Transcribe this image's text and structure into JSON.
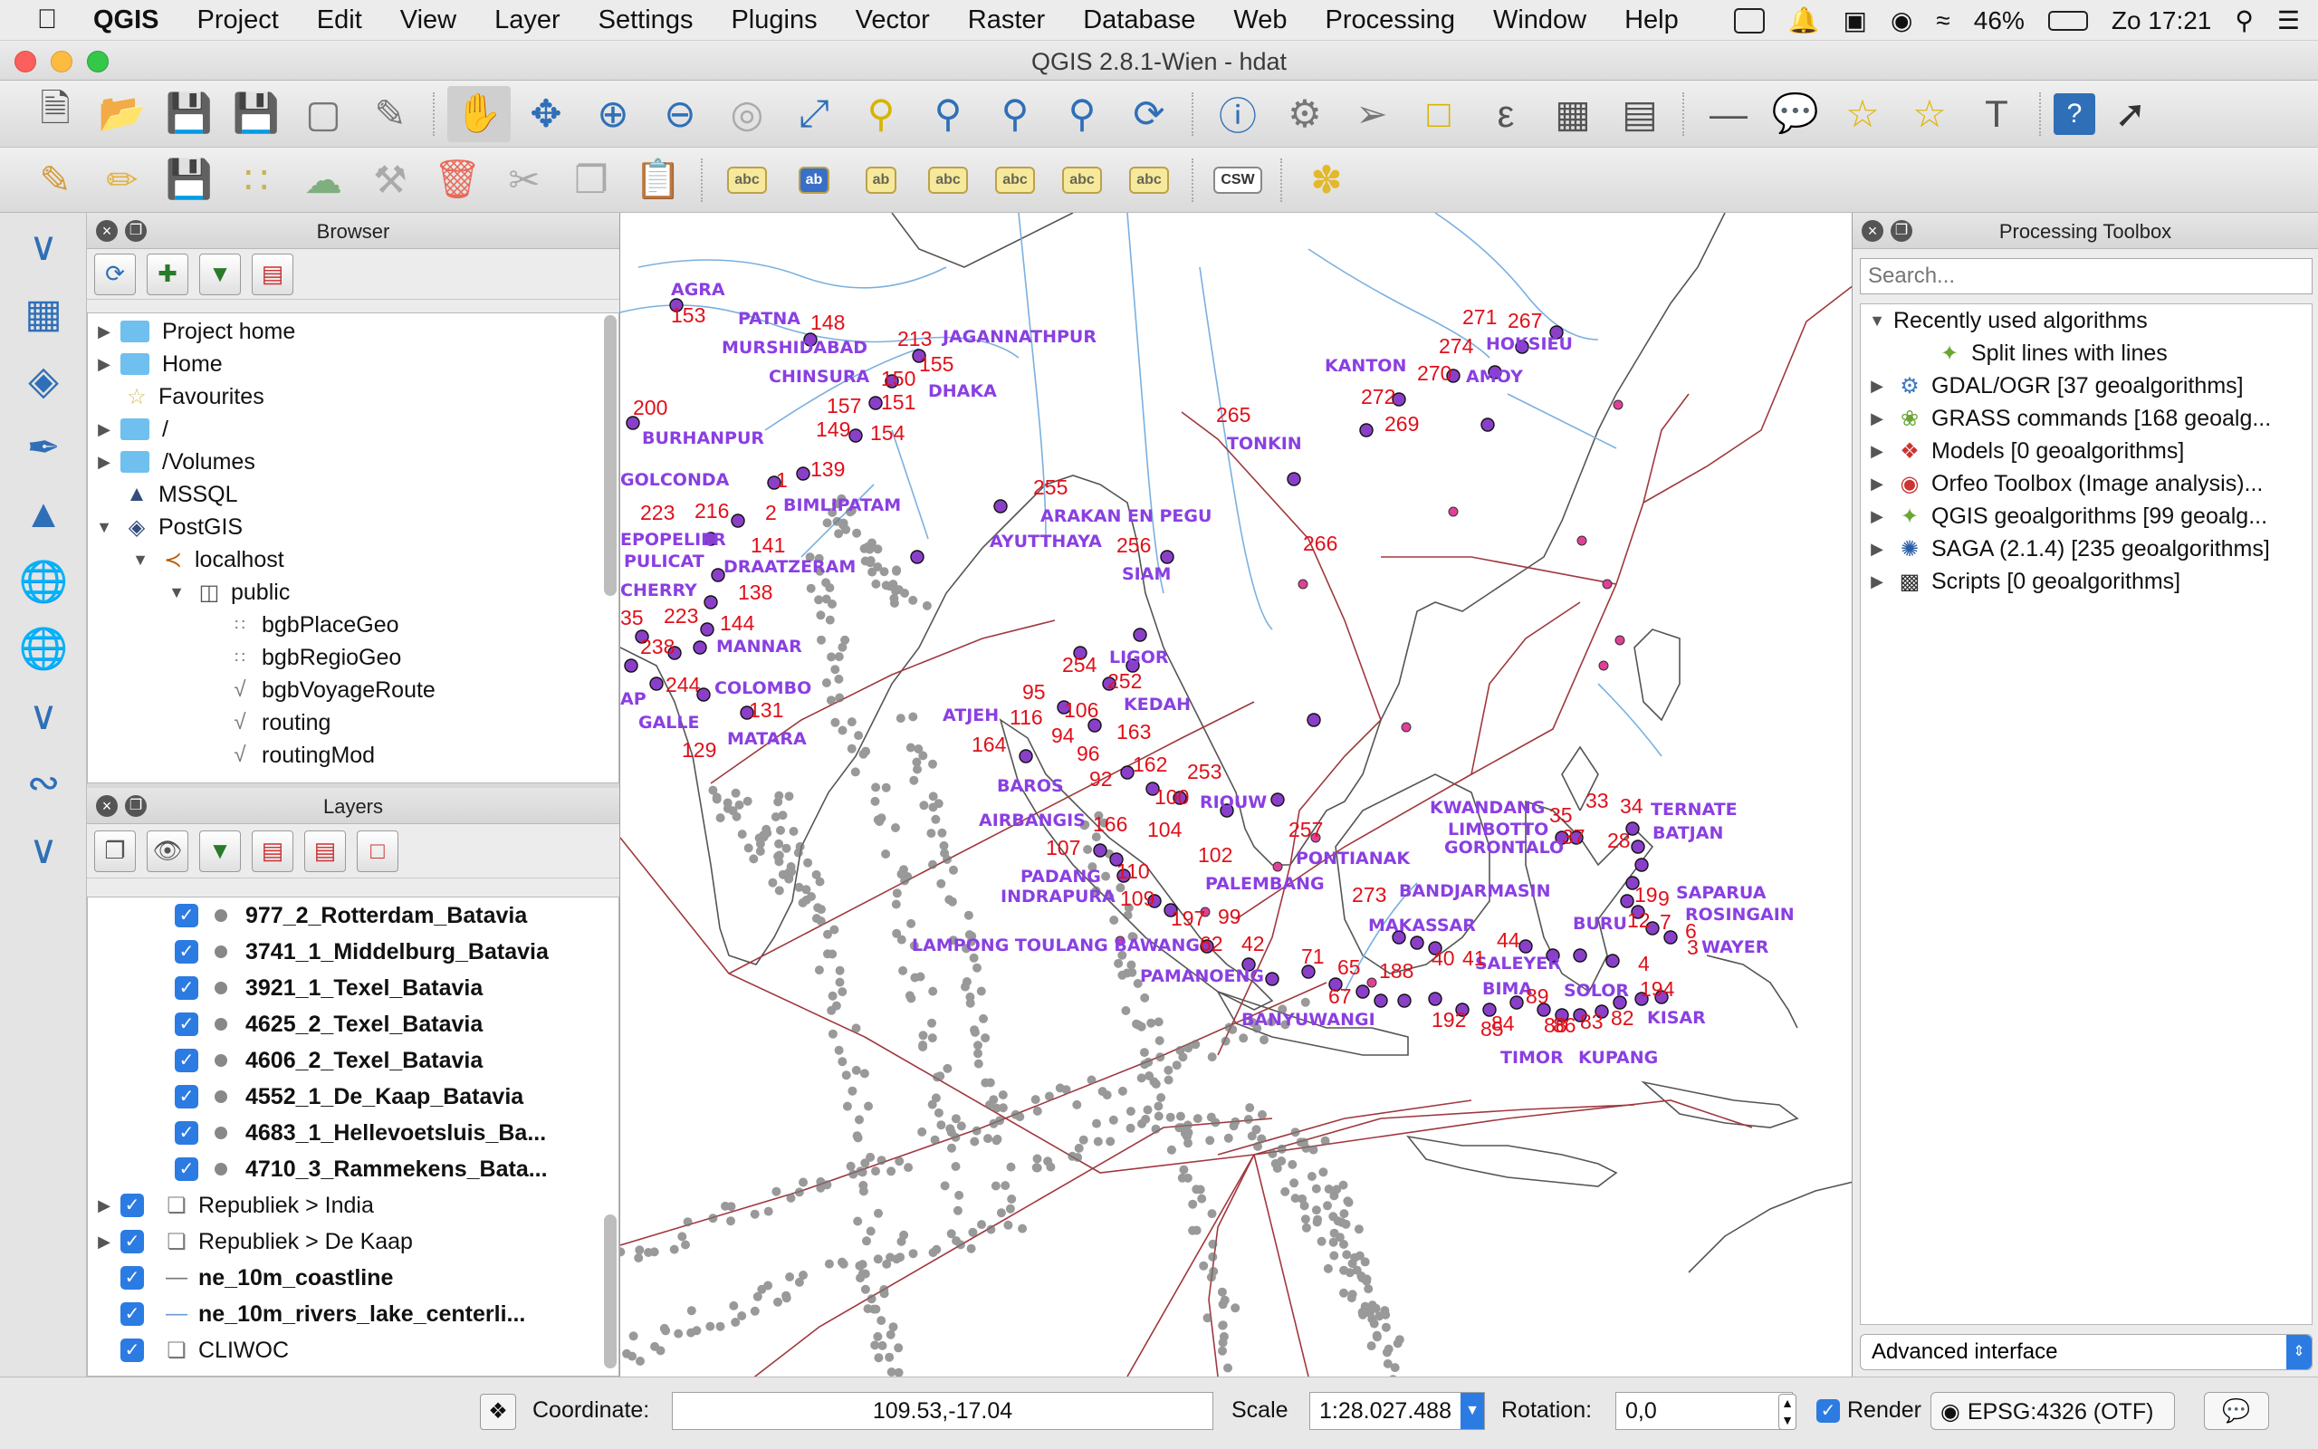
{
  "menubar": {
    "app": "QGIS",
    "items": [
      "Project",
      "Edit",
      "View",
      "Layer",
      "Settings",
      "Plugins",
      "Vector",
      "Raster",
      "Database",
      "Web",
      "Processing",
      "Window",
      "Help"
    ],
    "battery": "46%",
    "clock": "Zo 17:21"
  },
  "window": {
    "title": "QGIS 2.8.1-Wien - hdat"
  },
  "browser": {
    "title": "Browser",
    "items": [
      {
        "label": "Project home"
      },
      {
        "label": "Home"
      },
      {
        "label": "Favourites"
      },
      {
        "label": "/"
      },
      {
        "label": "/Volumes"
      },
      {
        "label": "MSSQL"
      },
      {
        "label": "PostGIS"
      },
      {
        "label": "localhost"
      },
      {
        "label": "public"
      },
      {
        "label": "bgbPlaceGeo"
      },
      {
        "label": "bgbRegioGeo"
      },
      {
        "label": "bgbVoyageRoute"
      },
      {
        "label": "routing"
      },
      {
        "label": "routingMod"
      }
    ]
  },
  "layers": {
    "title": "Layers",
    "items": [
      {
        "label": "977_2_Rotterdam_Batavia"
      },
      {
        "label": "3741_1_Middelburg_Batavia"
      },
      {
        "label": "3921_1_Texel_Batavia"
      },
      {
        "label": "4625_2_Texel_Batavia"
      },
      {
        "label": "4606_2_Texel_Batavia"
      },
      {
        "label": "4552_1_De_Kaap_Batavia"
      },
      {
        "label": "4683_1_Hellevoetsluis_Ba..."
      },
      {
        "label": "4710_3_Rammekens_Bata..."
      },
      {
        "label": "Republiek > India"
      },
      {
        "label": "Republiek > De Kaap"
      },
      {
        "label": "ne_10m_coastline"
      },
      {
        "label": "ne_10m_rivers_lake_centerli..."
      },
      {
        "label": "CLIWOC"
      }
    ]
  },
  "toolbox": {
    "title": "Processing Toolbox",
    "search_placeholder": "Search...",
    "items": [
      {
        "label": "Recently used algorithms"
      },
      {
        "label": "Split lines with lines"
      },
      {
        "label": "GDAL/OGR [37 geoalgorithms]"
      },
      {
        "label": "GRASS commands [168 geoalg..."
      },
      {
        "label": "Models [0 geoalgorithms]"
      },
      {
        "label": "Orfeo Toolbox (Image analysis)..."
      },
      {
        "label": "QGIS geoalgorithms [99 geoalg..."
      },
      {
        "label": "SAGA (2.1.4) [235 geoalgorithms]"
      },
      {
        "label": "Scripts [0 geoalgorithms]"
      }
    ],
    "mode": "Advanced interface"
  },
  "map": {
    "places": [
      {
        "label": "AGRA"
      },
      {
        "label": "PATNA"
      },
      {
        "label": "MURSHIDABAD"
      },
      {
        "label": "JAGANNATHPUR"
      },
      {
        "label": "CHINSURA"
      },
      {
        "label": "DHAKA"
      },
      {
        "label": "BURHANPUR"
      },
      {
        "label": "GOLCONDA"
      },
      {
        "label": "BIMLIPATAM"
      },
      {
        "label": "EPOPELIER"
      },
      {
        "label": "PULICAT"
      },
      {
        "label": "DRAATZERAM"
      },
      {
        "label": "CHERRY"
      },
      {
        "label": "MANNAR"
      },
      {
        "label": "COLOMBO"
      },
      {
        "label": "GALLE"
      },
      {
        "label": "MATARA"
      },
      {
        "label": "ARAKAN EN PEGU"
      },
      {
        "label": "AYUTTHAYA"
      },
      {
        "label": "SIAM"
      },
      {
        "label": "LIGOR"
      },
      {
        "label": "KEDAH"
      },
      {
        "label": "ATJEH"
      },
      {
        "label": "BAROS"
      },
      {
        "label": "AIRBANGIS"
      },
      {
        "label": "PADANG"
      },
      {
        "label": "INDRAPURA"
      },
      {
        "label": "RIOUW"
      },
      {
        "label": "PALEMBANG"
      },
      {
        "label": "LAMPONG TOULANG BAWANG"
      },
      {
        "label": "PAMANOENG"
      },
      {
        "label": "BANYUWANGI"
      },
      {
        "label": "PONTIANAK"
      },
      {
        "label": "BANDJARMASIN"
      },
      {
        "label": "MAKASSAR"
      },
      {
        "label": "SALEYER"
      },
      {
        "label": "BIMA"
      },
      {
        "label": "SOLOR"
      },
      {
        "label": "TIMOR"
      },
      {
        "label": "KUPANG"
      },
      {
        "label": "KISAR"
      },
      {
        "label": "KWANDANG"
      },
      {
        "label": "LIMBOTTO"
      },
      {
        "label": "GORONTALO"
      },
      {
        "label": "TERNATE"
      },
      {
        "label": "BATJAN"
      },
      {
        "label": "BURU"
      },
      {
        "label": "SAPARUA"
      },
      {
        "label": "ROSINGAIN"
      },
      {
        "label": "WAYER"
      },
      {
        "label": "KANTON"
      },
      {
        "label": "HOKSIEU"
      },
      {
        "label": "AMOY"
      },
      {
        "label": "TONKIN"
      },
      {
        "label": "AP"
      }
    ],
    "numbers": [
      "153",
      "148",
      "213",
      "155",
      "150",
      "157",
      "151",
      "154",
      "149",
      "200",
      "1",
      "139",
      "223",
      "216",
      "2",
      "141",
      "138",
      "223",
      "144",
      "35",
      "238",
      "244",
      "131",
      "129",
      "255",
      "256",
      "254",
      "252",
      "95",
      "116",
      "106",
      "163",
      "94",
      "96",
      "164",
      "92",
      "162",
      "253",
      "100",
      "104",
      "166",
      "107",
      "110",
      "109",
      "102",
      "197",
      "99",
      "62",
      "42",
      "257",
      "273",
      "35",
      "33",
      "34",
      "37",
      "28",
      "9",
      "7",
      "6",
      "3",
      "4",
      "44",
      "40",
      "41",
      "89",
      "86",
      "83",
      "82",
      "84",
      "85",
      "88",
      "192",
      "194",
      "188",
      "67",
      "65",
      "71",
      "265",
      "272",
      "269",
      "271",
      "267",
      "274",
      "270",
      "266",
      "12",
      "19"
    ]
  },
  "status": {
    "coordinate_label": "Coordinate:",
    "coordinate_value": "109.53,-17.04",
    "scale_label": "Scale",
    "scale_value": "1:28.027.488",
    "rotation_label": "Rotation:",
    "rotation_value": "0,0",
    "render_label": "Render",
    "crs": "EPSG:4326 (OTF)"
  }
}
